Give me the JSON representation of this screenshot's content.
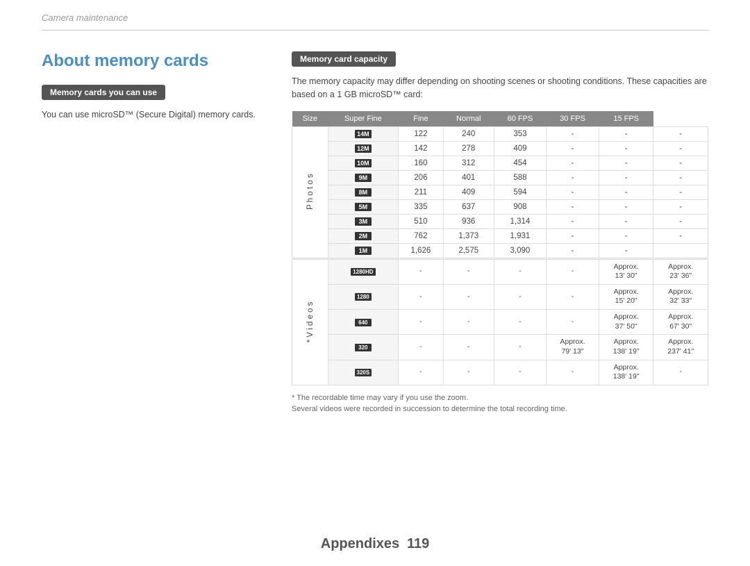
{
  "header": {
    "breadcrumb": "Camera maintenance"
  },
  "left": {
    "page_title": "About memory cards",
    "badge1": "Memory cards you can use",
    "text1": "You can use microSD™ (Secure Digital) memory cards."
  },
  "right": {
    "badge": "Memory card capacity",
    "intro": "The memory capacity may differ depending on shooting scenes or shooting conditions. These capacities are based on a 1 GB microSD™ card:",
    "table": {
      "headers": [
        "Size",
        "Super Fine",
        "Fine",
        "Normal",
        "60 FPS",
        "30 FPS",
        "15 FPS"
      ],
      "photos_label": "Photos",
      "videos_label": "* Videos",
      "photo_rows": [
        {
          "icon": "14M",
          "sf": "122",
          "f": "240",
          "n": "353",
          "fps60": "-",
          "fps30": "-",
          "fps15": "-"
        },
        {
          "icon": "12M",
          "sf": "142",
          "f": "278",
          "n": "409",
          "fps60": "-",
          "fps30": "-",
          "fps15": "-"
        },
        {
          "icon": "10M",
          "sf": "160",
          "f": "312",
          "n": "454",
          "fps60": "-",
          "fps30": "-",
          "fps15": "-"
        },
        {
          "icon": "9M",
          "sf": "206",
          "f": "401",
          "n": "588",
          "fps60": "-",
          "fps30": "-",
          "fps15": "-"
        },
        {
          "icon": "8M",
          "sf": "211",
          "f": "409",
          "n": "594",
          "fps60": "-",
          "fps30": "-",
          "fps15": "-"
        },
        {
          "icon": "5M",
          "sf": "335",
          "f": "637",
          "n": "908",
          "fps60": "-",
          "fps30": "-",
          "fps15": "-"
        },
        {
          "icon": "3M",
          "sf": "510",
          "f": "936",
          "n": "1,314",
          "fps60": "-",
          "fps30": "-",
          "fps15": "-"
        },
        {
          "icon": "2M",
          "sf": "762",
          "f": "1,373",
          "n": "1,931",
          "fps60": "-",
          "fps30": "-",
          "fps15": "-"
        },
        {
          "icon": "1M",
          "sf": "1,626",
          "f": "2,575",
          "n": "3,090",
          "fps60": "-",
          "fps30": "-",
          "fps15": ""
        }
      ],
      "video_rows": [
        {
          "icon": "1280HD",
          "sf": "-",
          "f": "-",
          "n": "-",
          "fps60": "-",
          "fps30": "Approx.\n13' 30\"",
          "fps15": "Approx.\n23' 36\""
        },
        {
          "icon": "1280",
          "sf": "-",
          "f": "-",
          "n": "-",
          "fps60": "-",
          "fps30": "Approx.\n15' 20\"",
          "fps15": "Approx.\n32' 33\""
        },
        {
          "icon": "640",
          "sf": "-",
          "f": "-",
          "n": "-",
          "fps60": "-",
          "fps30": "Approx.\n37' 50\"",
          "fps15": "Approx.\n67' 30\""
        },
        {
          "icon": "320",
          "sf": "-",
          "f": "-",
          "n": "-",
          "fps60": "Approx.\n79' 13\"",
          "fps30": "Approx.\n138' 19\"",
          "fps15": "Approx.\n237' 41\""
        },
        {
          "icon": "320S",
          "sf": "-",
          "f": "-",
          "n": "-",
          "fps60": "-",
          "fps30": "Approx.\n138' 19\"",
          "fps15": "-"
        }
      ]
    },
    "footnote1": "* The recordable time may vary if you use the zoom.",
    "footnote2": "Several videos were recorded in succession to determine the total recording time."
  },
  "footer": {
    "label": "Appendixes",
    "page": "119"
  }
}
